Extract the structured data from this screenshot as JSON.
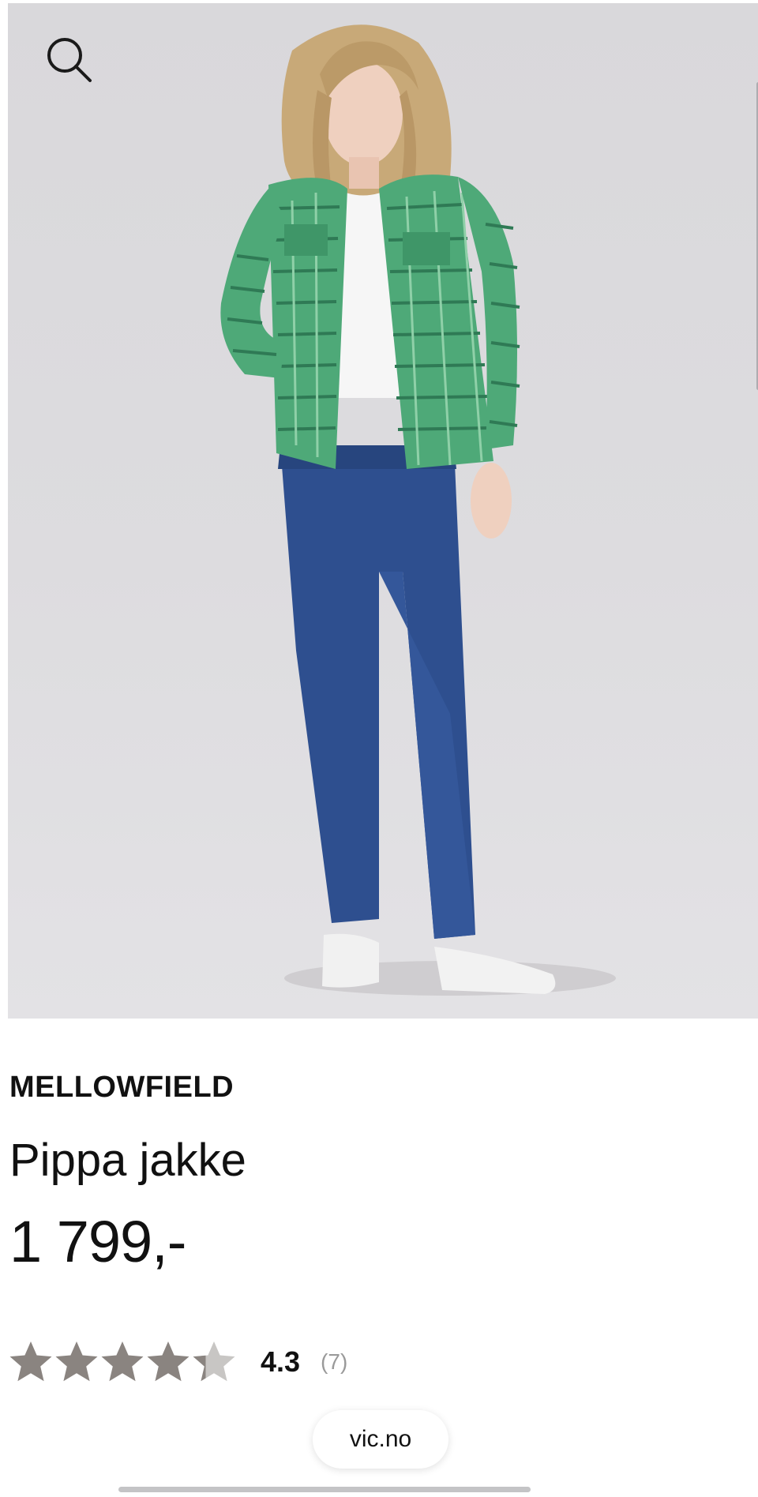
{
  "product": {
    "brand": "MELLOWFIELD",
    "name": "Pippa jakke",
    "price": "1 799,-",
    "image_icon": "model-wearing-green-tweed-jacket-photo"
  },
  "rating": {
    "value": "4.3",
    "count": "(7)",
    "stars_filled": 4.3,
    "stars_max": 5,
    "star_color": "#8a8480",
    "star_empty_color": "#c8c6c4"
  },
  "browser": {
    "url": "vic.no"
  },
  "icons": {
    "search": "search-icon"
  },
  "colors": {
    "background": "#ffffff",
    "text": "#111111",
    "muted": "#9a9a9a",
    "photo_background": "#dcdbde"
  }
}
